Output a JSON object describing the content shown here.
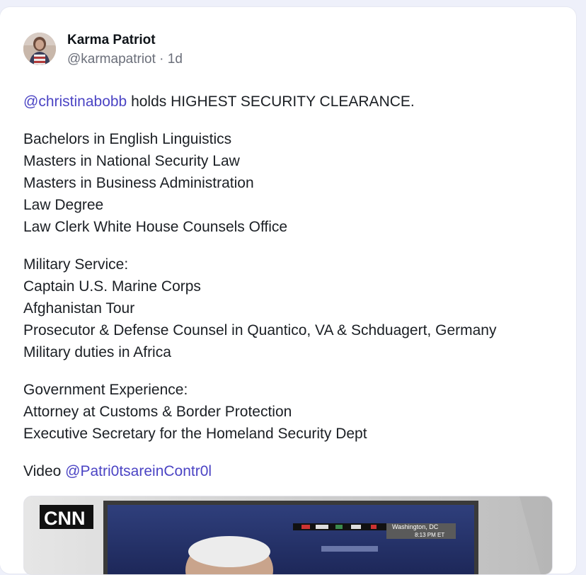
{
  "post": {
    "author": {
      "display_name": "Karma Patriot",
      "handle": "@karmapatriot",
      "separator": "·",
      "age": "1d"
    },
    "text": {
      "intro_mention": "@christinabobb",
      "intro_rest": " holds HIGHEST SECURITY CLEARANCE.",
      "education": [
        "Bachelors in English Linguistics",
        "Masters in National Security Law",
        "Masters in Business Administration",
        "Law Degree",
        "Law Clerk White House Counsels Office"
      ],
      "military_heading": "Military Service:",
      "military": [
        "Captain U.S. Marine Corps",
        "Afghanistan Tour",
        "Prosecutor & Defense Counsel in Quantico, VA & Schduagert, Germany",
        "Military duties in Africa"
      ],
      "government_heading": "Government Experience:",
      "government": [
        "Attorney at Customs & Border Protection",
        "Executive Secretary for the Homeland Security Dept"
      ],
      "video_prefix": "Video ",
      "video_mention": "@Patri0tsareinContr0l"
    },
    "media": {
      "logo_text": "CNN",
      "location_text": "Washington, DC",
      "time_text": "8:13 PM ET"
    }
  },
  "colors": {
    "mention": "#4b44c4",
    "page_background": "#eef0fa"
  }
}
